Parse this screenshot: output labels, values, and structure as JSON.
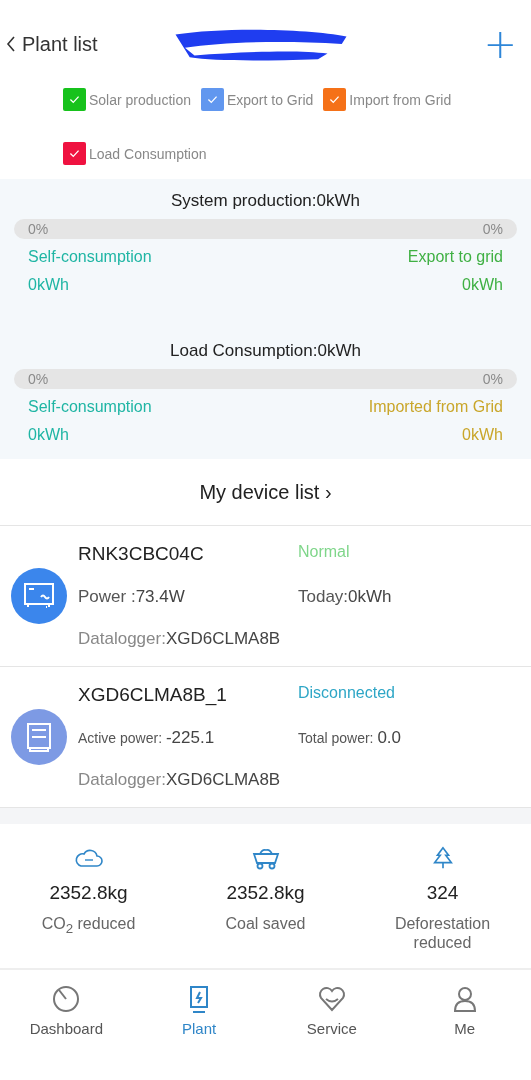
{
  "header": {
    "back_label": "Plant list",
    "add_button": "+"
  },
  "legend": [
    {
      "label": "Solar production",
      "checked": true,
      "color": "#17c21c"
    },
    {
      "label": "Export to Grid",
      "checked": true,
      "color": "#6197ef"
    },
    {
      "label": "Import from Grid",
      "checked": true,
      "color": "#f57118"
    },
    {
      "label": "Load Consumption",
      "checked": true,
      "color": "#ef1240"
    }
  ],
  "energy": [
    {
      "kind": "production",
      "title": "System production:0kWh",
      "level": 0,
      "left_percent": "0%",
      "right_percent": "0%",
      "left_label": "Self-consumption",
      "left_value": "0kWh",
      "right_label": "Export to grid",
      "right_value": "0kWh"
    },
    {
      "kind": "load",
      "title": "Load Consumption:0kWh",
      "level": 0,
      "left_percent": "0%",
      "right_percent": "0%",
      "left_label": "Self-consumption",
      "left_value": "0kWh",
      "right_label": "Imported from Grid",
      "right_value": "0kWh"
    }
  ],
  "device_list": {
    "title": "My device list",
    "chevron": "›"
  },
  "devices": [
    {
      "kind": "inverter",
      "name": "RNK3CBC04C",
      "status": "Normal",
      "color": "#7fd68a",
      "stats": [
        {
          "label": "Power :",
          "value": "73.4W"
        },
        {
          "label": "Today:",
          "value": "0kWh"
        }
      ],
      "datalogger_label": "Datalogger:",
      "datalogger_value": "XGD6CLMA8B"
    },
    {
      "kind": "meter",
      "name": "XGD6CLMA8B_1",
      "status": "Disconnected",
      "color": "#2ea6c6",
      "stats": [
        {
          "label": "Active power: ",
          "value": "-225.1"
        },
        {
          "label": "Total power: ",
          "value": "0.0"
        }
      ],
      "datalogger_label": "Datalogger:",
      "datalogger_value": "XGD6CLMA8B"
    }
  ],
  "stats": [
    {
      "kind": "co2",
      "value": "2352.8kg",
      "label": "CO$_{2}$ reduced"
    },
    {
      "kind": "coal",
      "value": "2352.8kg",
      "label": "Coal saved"
    },
    {
      "kind": "tree",
      "value": "324",
      "label": "Deforestation reduced"
    }
  ],
  "tabs": [
    {
      "kind": "dashboard",
      "label": "Dashboard",
      "selected": false
    },
    {
      "kind": "plant",
      "label": "Plant",
      "selected": true
    },
    {
      "kind": "service",
      "label": "Service",
      "selected": false
    },
    {
      "kind": "me",
      "label": "Me",
      "selected": false
    }
  ]
}
